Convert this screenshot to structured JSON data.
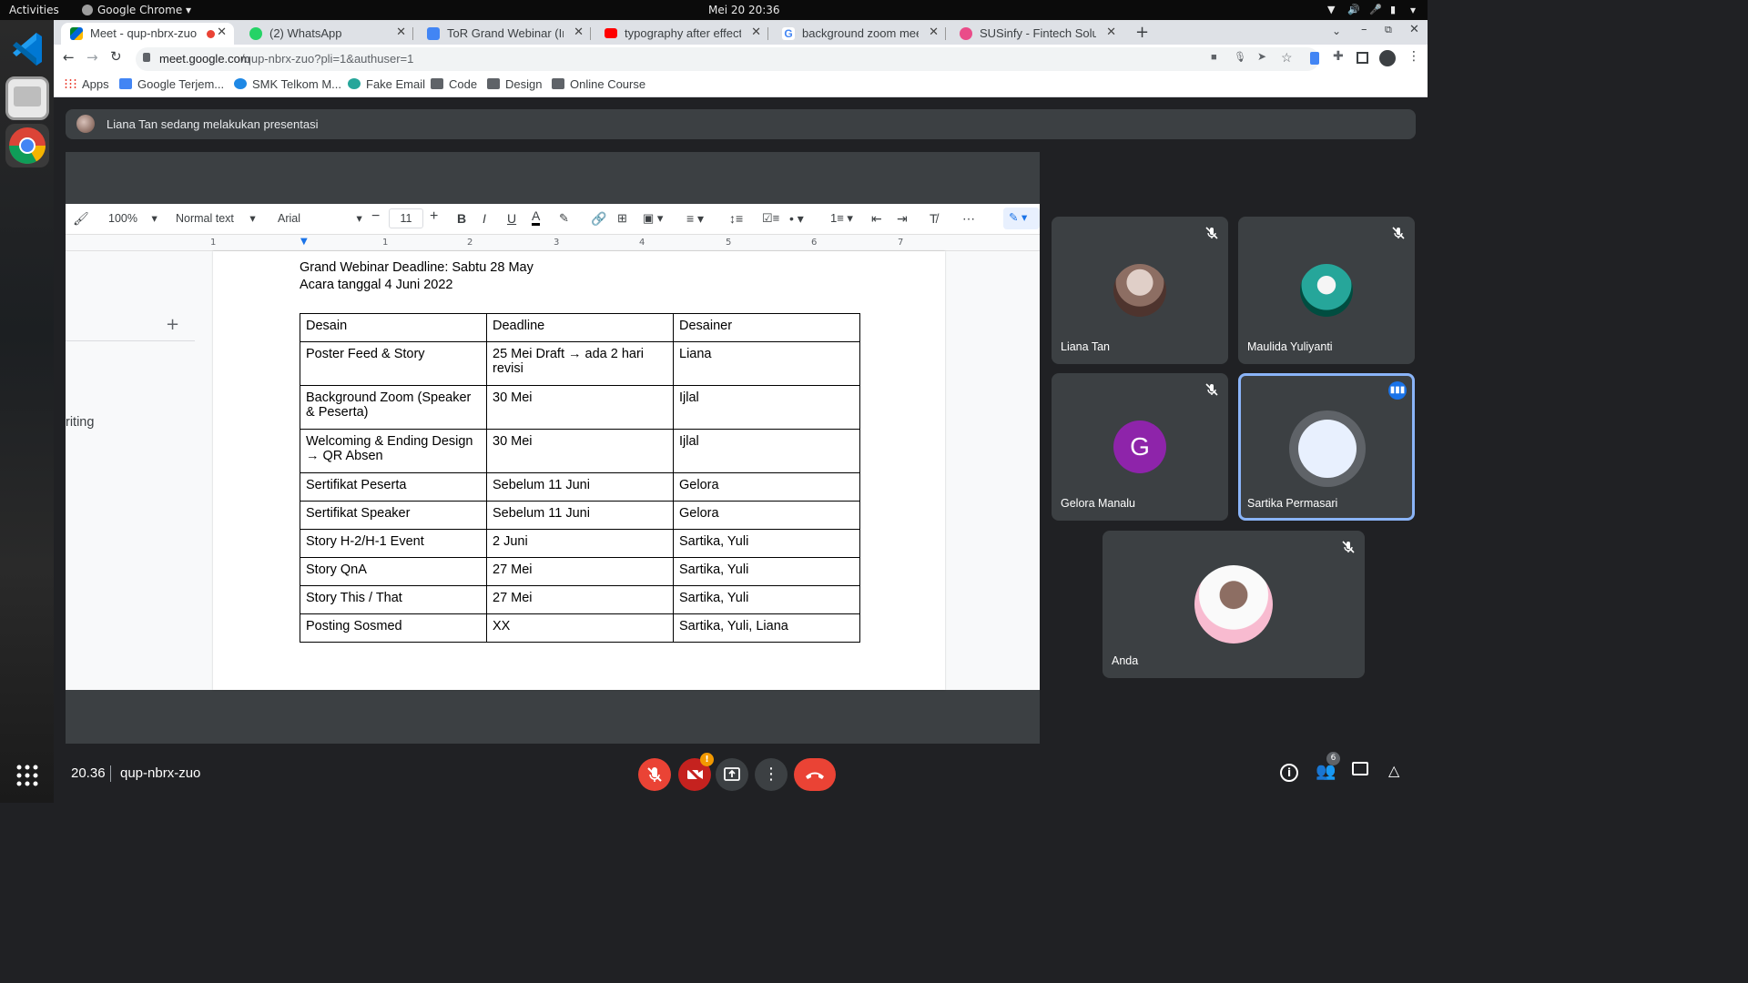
{
  "system": {
    "activities": "Activities",
    "app_name": "Google Chrome",
    "clock": "Mei 20  20:36"
  },
  "browser": {
    "tabs": [
      {
        "title": "Meet - qup-nbrx-zuo",
        "icon": "google-meet-icon"
      },
      {
        "title": "(2) WhatsApp",
        "icon": "whatsapp-icon"
      },
      {
        "title": "ToR Grand Webinar (Indo",
        "icon": "google-docs-icon"
      },
      {
        "title": "typography after effects t",
        "icon": "youtube-icon"
      },
      {
        "title": "background zoom meetin",
        "icon": "google-icon"
      },
      {
        "title": "SUSinfy - Fintech Solution",
        "icon": "dribbble-icon"
      }
    ],
    "url_host": "meet.google.com",
    "url_path": "/qup-nbrx-zuo?pli=1&authuser=1",
    "bookmarks": [
      "Apps",
      "Google Terjem...",
      "SMK Telkom M...",
      "Fake Email",
      "Code",
      "Design",
      "Online Course"
    ]
  },
  "meet": {
    "presenting_banner": "Liana Tan sedang melakukan presentasi",
    "time": "20.36",
    "meeting_code": "qup-nbrx-zuo",
    "participants_count": "6",
    "participants": [
      {
        "name": "Liana Tan",
        "muted": true
      },
      {
        "name": "Maulida Yuliyanti",
        "muted": true
      },
      {
        "name": "Gelora Manalu",
        "initial": "G",
        "muted": true,
        "avatar_color": "#8e24aa"
      },
      {
        "name": "Sartika Permasari",
        "muted": false,
        "speaking": true
      },
      {
        "name": "Anda",
        "muted": true
      }
    ]
  },
  "docs": {
    "zoom": "100%",
    "style": "Normal text",
    "font": "Arial",
    "font_size": "11",
    "sidebar_text": "riting",
    "ruler_marks": [
      "1",
      "1",
      "2",
      "3",
      "4",
      "5",
      "6",
      "7"
    ],
    "heading_line1": "Grand Webinar Deadline: Sabtu 28 May",
    "heading_line2": "Acara tanggal 4 Juni 2022",
    "table": {
      "headers": [
        "Desain",
        "Deadline",
        "Desainer"
      ],
      "rows": [
        [
          "Poster Feed & Story",
          "25 Mei Draft → ada 2 hari revisi",
          "Liana"
        ],
        [
          "Background Zoom (Speaker & Peserta)",
          "30 Mei",
          "Ijlal"
        ],
        [
          "Welcoming & Ending Design → QR Absen",
          "30 Mei",
          "Ijlal"
        ],
        [
          "Sertifikat Peserta",
          "Sebelum 11 Juni",
          "Gelora"
        ],
        [
          "Sertifikat Speaker",
          "Sebelum 11 Juni",
          "Gelora"
        ],
        [
          "Story H-2/H-1 Event",
          "2 Juni",
          "Sartika, Yuli"
        ],
        [
          "Story QnA",
          "27 Mei",
          "Sartika, Yuli"
        ],
        [
          "Story This / That",
          "27 Mei",
          "Sartika, Yuli"
        ],
        [
          "Posting Sosmed",
          "XX",
          "Sartika, Yuli, Liana"
        ]
      ]
    }
  }
}
